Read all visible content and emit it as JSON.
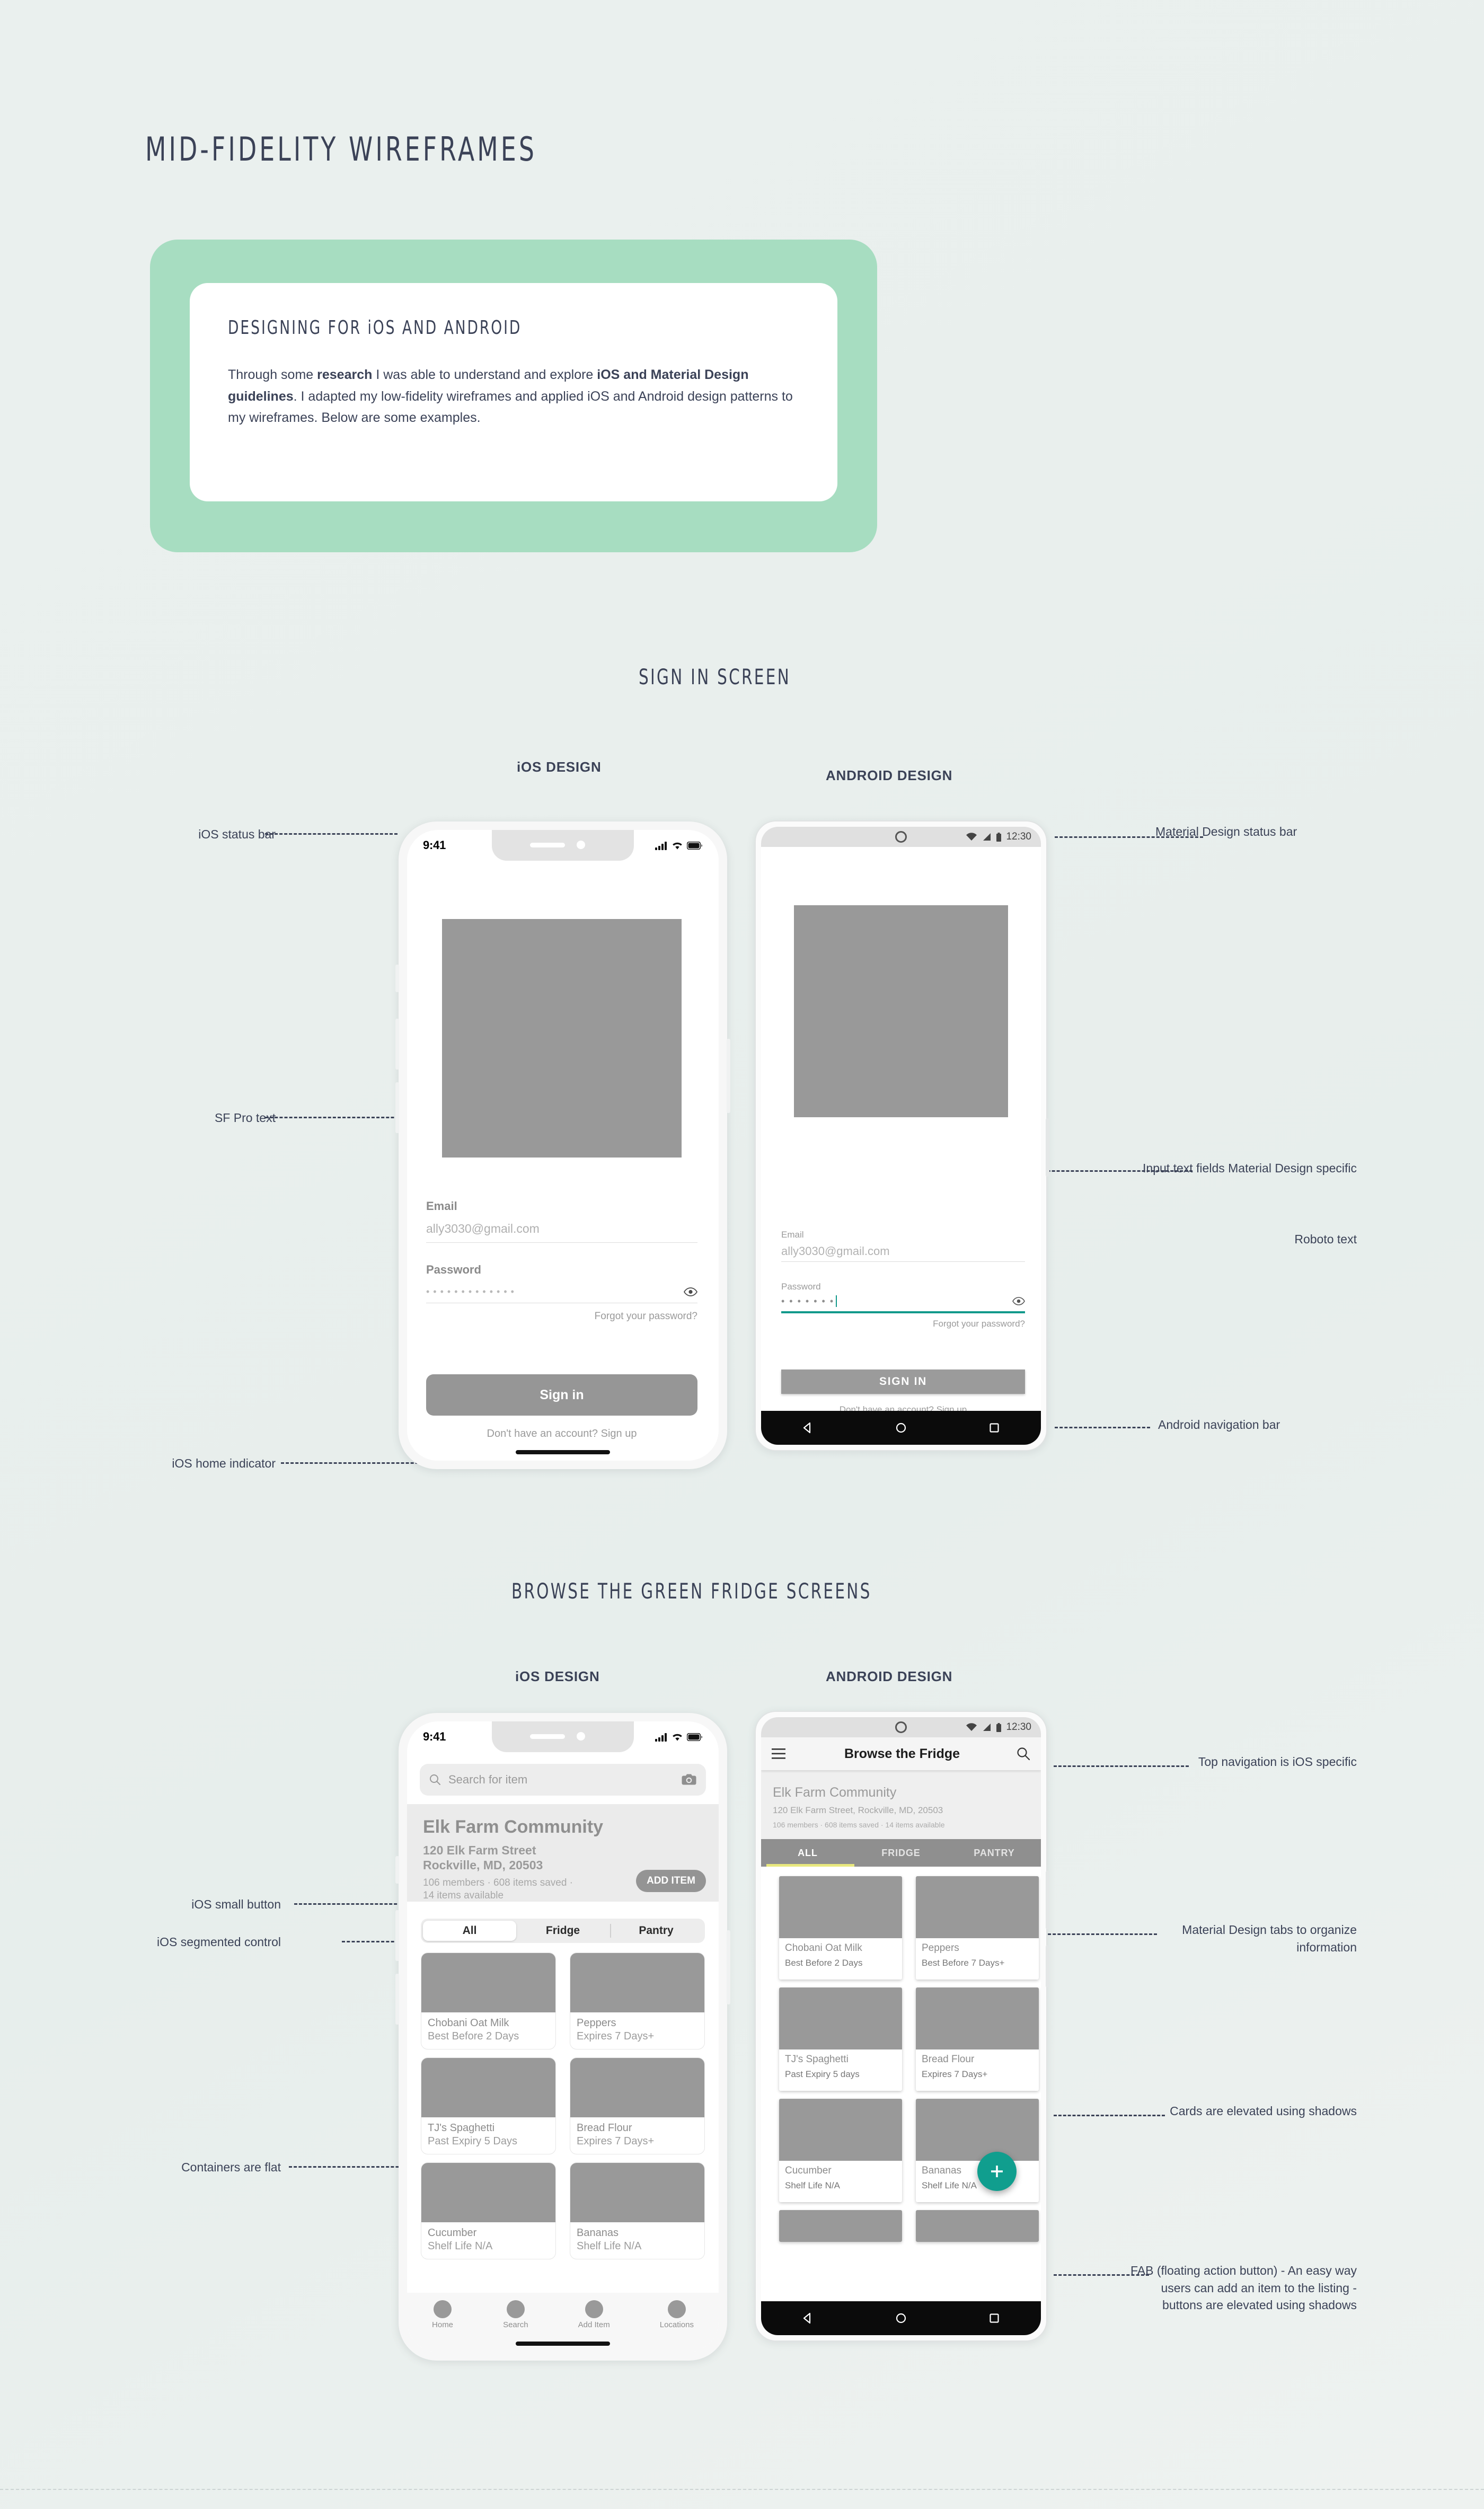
{
  "page": {
    "title": "MID-FIDELITY WIREFRAMES"
  },
  "intro": {
    "heading": "DESIGNING FOR iOS AND ANDROID",
    "body_part1": "Through some ",
    "body_bold1": "research",
    "body_part2": " I was able to understand and explore ",
    "body_bold2": "iOS and Material Design guidelines",
    "body_part3": ". I adapted my low-fidelity wireframes and applied iOS and Android design patterns to my wireframes. Below are some examples."
  },
  "sections": {
    "sign_in": {
      "title": "SIGN IN SCREEN",
      "ios_label": "iOS DESIGN",
      "android_label": "ANDROID DESIGN",
      "annotations": {
        "left": [
          "iOS status bar",
          "SF Pro text",
          "iOS home indicator"
        ],
        "right": [
          "Material Design status bar",
          "Input text fields Material Design specific",
          "Roboto text",
          "Android navigation bar"
        ]
      }
    },
    "browse": {
      "title": "BROWSE THE GREEN FRIDGE SCREENS",
      "ios_label": "iOS DESIGN",
      "android_label": "ANDROID DESIGN",
      "annotations": {
        "left": [
          "iOS small button",
          "iOS segmented control",
          "Containers are flat"
        ],
        "right": [
          "Top navigation is iOS specific",
          "Material Design tabs to organize information",
          "Cards are elevated using shadows",
          "FAB (floating action button) - An easy way users can add an item to the listing - buttons are elevated using shadows"
        ]
      }
    }
  },
  "ios_signin": {
    "status_time": "9:41",
    "email_label": "Email",
    "email_value": "ally3030@gmail.com",
    "password_label": "Password",
    "password_value": "• • • • • • • • • • • • •",
    "forgot_link": "Forgot your password?",
    "signin_button": "Sign in",
    "signup_link": "Don't have an account? Sign up"
  },
  "android_signin": {
    "status_time": "12:30",
    "email_label": "Email",
    "email_value": "ally3030@gmail.com",
    "password_label": "Password",
    "password_value": "• • • • • • •",
    "forgot_link": "Forgot your password?",
    "signin_button": "SIGN IN",
    "signup_link": "Don't have an account? Sign up"
  },
  "ios_browse": {
    "status_time": "9:41",
    "search_placeholder": "Search for item",
    "community_name": "Elk Farm Community",
    "address_line1": "120 Elk Farm Street",
    "address_line2": "Rockville, MD, 20503",
    "stats_line1": "106 members · 608 items saved ·",
    "stats_line2": "14 items available",
    "add_item_button": "ADD ITEM",
    "segments": [
      "All",
      "Fridge",
      "Pantry"
    ],
    "selected_segment": "All",
    "cards": [
      {
        "title": "Chobani Oat Milk",
        "sub": "Best Before 2 Days"
      },
      {
        "title": "Peppers",
        "sub": "Expires 7 Days+"
      },
      {
        "title": "TJ's Spaghetti",
        "sub": "Past Expiry 5 Days"
      },
      {
        "title": "Bread Flour",
        "sub": "Expires 7 Days+"
      },
      {
        "title": "Cucumber",
        "sub": "Shelf Life N/A"
      },
      {
        "title": "Bananas",
        "sub": "Shelf Life N/A"
      }
    ],
    "tabs": [
      "Home",
      "Search",
      "Add Item",
      "Locations"
    ]
  },
  "android_browse": {
    "status_time": "12:30",
    "appbar_title": "Browse the Fridge",
    "community_name": "Elk Farm Community",
    "address": "120 Elk Farm Street, Rockville, MD, 20503",
    "stats": "106 members · 608 items saved · 14 items available",
    "tabs": [
      "ALL",
      "FRIDGE",
      "PANTRY"
    ],
    "selected_tab": "ALL",
    "cards": [
      {
        "title": "Chobani Oat Milk",
        "sub": "Best Before 2 Days"
      },
      {
        "title": "Peppers",
        "sub": "Best Before 7 Days+"
      },
      {
        "title": "TJ's Spaghetti",
        "sub": "Past Expiry 5 days"
      },
      {
        "title": "Bread Flour",
        "sub": "Expires 7 Days+"
      },
      {
        "title": "Cucumber",
        "sub": "Shelf Life N/A"
      },
      {
        "title": "Bananas",
        "sub": "Shelf Life N/A"
      }
    ],
    "fab_icon": "+"
  },
  "colors": {
    "accent_green": "#a7ddc1",
    "fab_teal": "#109e8e",
    "material_underline": "#12998b",
    "tab_indicator": "#e8e87e",
    "text_navy": "#3b4257",
    "placeholder_grey": "#999999"
  }
}
